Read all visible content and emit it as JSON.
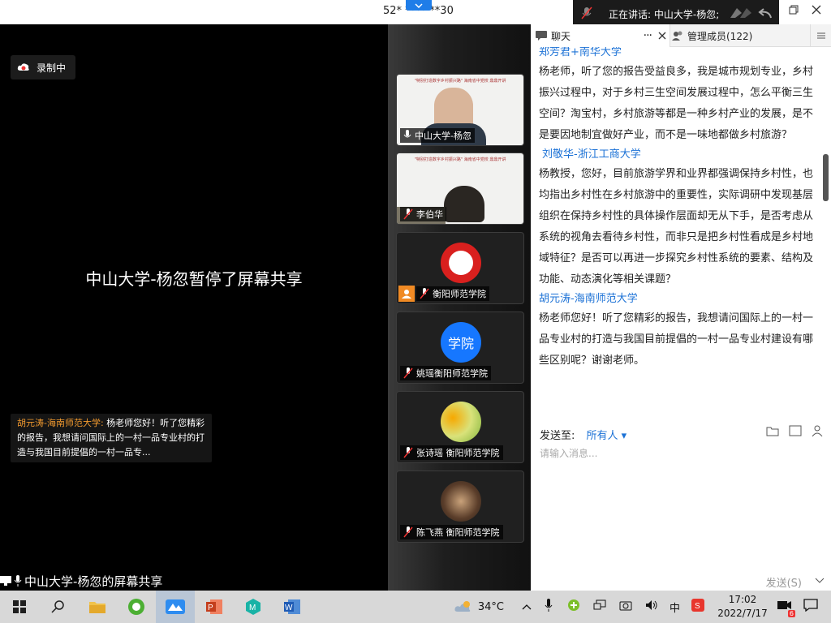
{
  "topbar": {
    "meeting_id": "52* **** **30"
  },
  "speaking": {
    "label": "正在讲话: 中山大学-杨忽;"
  },
  "main": {
    "recording_label": "录制中",
    "paused_message": "中山大学-杨忽暂停了屏幕共享",
    "toast": {
      "name": "胡元涛-海南师范大学:",
      "text": "杨老师您好！听了您精彩的报告，我想请问国际上的一村一品专业村的打造与我国目前提倡的一村一品专..."
    },
    "share_label": "中山大学-杨忽的屏幕共享"
  },
  "participants": [
    {
      "name": "中山大学-杨忽",
      "kind": "video-speaker"
    },
    {
      "name": "李伯华",
      "kind": "video"
    },
    {
      "name": "衡阳师范学院",
      "kind": "logo"
    },
    {
      "name": "姚瑶衡阳师范学院",
      "kind": "avatar",
      "avatar_text": "学院"
    },
    {
      "name": "张诗瑶 衡阳师范学院",
      "kind": "photo"
    },
    {
      "name": "陈飞燕 衡阳师范学院",
      "kind": "photo"
    }
  ],
  "chat": {
    "tab_chat": "聊天",
    "tab_members": "管理成员(122)",
    "messages": [
      {
        "sender": "郑芳君+南华大学",
        "text": "杨老师，听了您的报告受益良多，我是城市规划专业，乡村振兴过程中，对于乡村三生空间发展过程中，怎么平衡三生空间？淘宝村，乡村旅游等都是一种乡村产业的发展，是不是要因地制宜做好产业，而不是一味地都做乡村旅游？"
      },
      {
        "sender": "刘敬华-浙江工商大学",
        "text": "杨教授，您好，目前旅游学界和业界都强调保持乡村性，也均指出乡村性在乡村旅游中的重要性，实际调研中发现基层组织在保持乡村性的具体操作层面却无从下手，是否考虑从系统的视角去看待乡村性，而非只是把乡村性看成是乡村地域特征？是否可以再进一步探究乡村性系统的要素、结构及功能、动态演化等相关课题？"
      },
      {
        "sender": "胡元涛-海南师范大学",
        "text": "杨老师您好！听了您精彩的报告，我想请问国际上的一村一品专业村的打造与我国目前提倡的一村一品专业村建设有哪些区别呢？谢谢老师。"
      }
    ],
    "send_to_label": "发送至:",
    "send_to_value": "所有人",
    "input_placeholder": "请输入消息...",
    "send_button": "发送(S)"
  },
  "taskbar": {
    "weather": "34°C",
    "ime": "中",
    "time": "17:02",
    "date": "2022/7/17",
    "notif_count": "6"
  }
}
